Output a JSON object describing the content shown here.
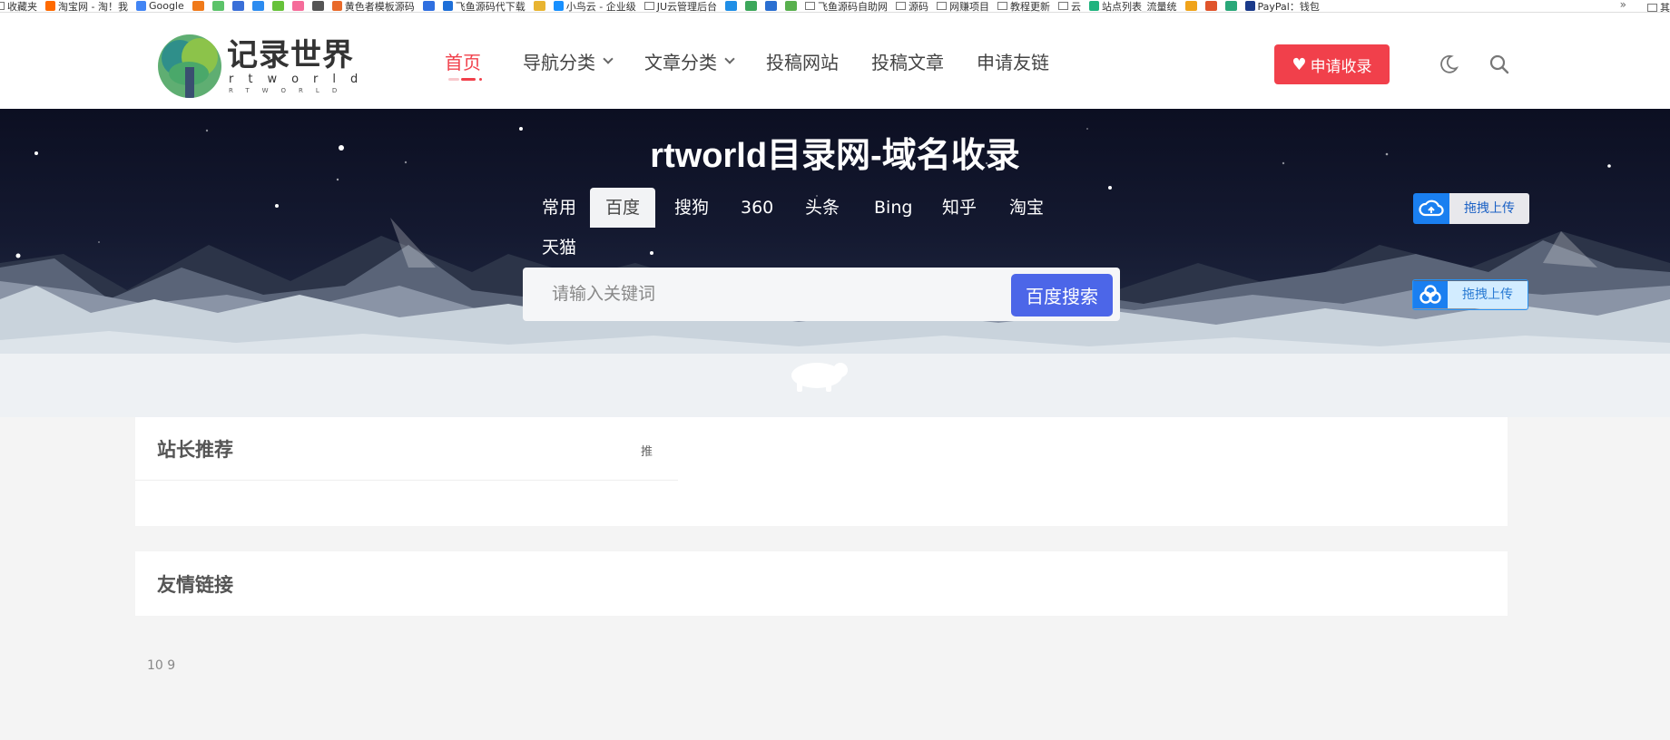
{
  "bookmarks": {
    "items": [
      {
        "label": "收藏夹",
        "color": ""
      },
      {
        "label": "淘宝网 - 淘！我",
        "color": "#ff6a00"
      },
      {
        "label": "Google",
        "color": "#4285f4"
      },
      {
        "label": "",
        "color": "#f07a1a"
      },
      {
        "label": "",
        "color": "#5cc36a"
      },
      {
        "label": "",
        "color": "#3a6fd8"
      },
      {
        "label": "",
        "color": "#2d8cf0"
      },
      {
        "label": "",
        "color": "#67c23a"
      },
      {
        "label": "",
        "color": "#f56c9a"
      },
      {
        "label": "",
        "color": "#555555"
      },
      {
        "label": "黄色者模板源码",
        "color": "#e96a2a"
      },
      {
        "label": "",
        "color": "#2f6fe0"
      },
      {
        "label": "飞鱼源码代下载",
        "color": "#1e6fd8"
      },
      {
        "label": "",
        "color": "#e8b431"
      },
      {
        "label": "小鸟云 - 企业级",
        "color": "#1890ff"
      },
      {
        "label": "JU云管理后台",
        "color": ""
      },
      {
        "label": "",
        "color": "#1f8ee6"
      },
      {
        "label": "",
        "color": "#3da75b"
      },
      {
        "label": "",
        "color": "#2a6fd1"
      },
      {
        "label": "",
        "color": "#59b04e"
      },
      {
        "label": "飞鱼源码自助网",
        "color": ""
      },
      {
        "label": "源码",
        "color": ""
      },
      {
        "label": "网赚项目",
        "color": ""
      },
      {
        "label": "教程更新",
        "color": ""
      },
      {
        "label": "云",
        "color": ""
      },
      {
        "label": "站点列表_流量统",
        "color": "#1fb37e"
      },
      {
        "label": "",
        "color": "#f0a31a"
      },
      {
        "label": "",
        "color": "#e0542b"
      },
      {
        "label": "",
        "color": "#2aa879"
      },
      {
        "label": "PayPal：钱包",
        "color": "#1a3a8a"
      }
    ],
    "more": "»",
    "last": "其"
  },
  "header": {
    "logo_cn": "记录世界",
    "logo_en": "rtworld",
    "logo_en_small": "RTWORLD",
    "nav": [
      {
        "label": "首页",
        "active": true,
        "dropdown": false
      },
      {
        "label": "导航分类",
        "active": false,
        "dropdown": true
      },
      {
        "label": "文章分类",
        "active": false,
        "dropdown": true
      },
      {
        "label": "投稿网站",
        "active": false,
        "dropdown": false
      },
      {
        "label": "投稿文章",
        "active": false,
        "dropdown": false
      },
      {
        "label": "申请友链",
        "active": false,
        "dropdown": false
      }
    ],
    "apply_label": "申请收录",
    "accent_color": "#f1404b"
  },
  "banner": {
    "title": "rtworld目录网-域名收录",
    "tabs": [
      "常用",
      "百度",
      "搜狗",
      "360",
      "头条",
      "Bing",
      "知乎",
      "淘宝",
      "天猫"
    ],
    "active_tab": "百度",
    "search_placeholder": "请输入关键词",
    "search_button": "百度搜索",
    "upload_label_1": "拖拽上传",
    "upload_label_2": "拖拽上传"
  },
  "sections": {
    "recommend_title": "站长推荐",
    "recommend_tag": "推",
    "links_title": "友情链接"
  },
  "footer": {
    "text": "10 9"
  }
}
